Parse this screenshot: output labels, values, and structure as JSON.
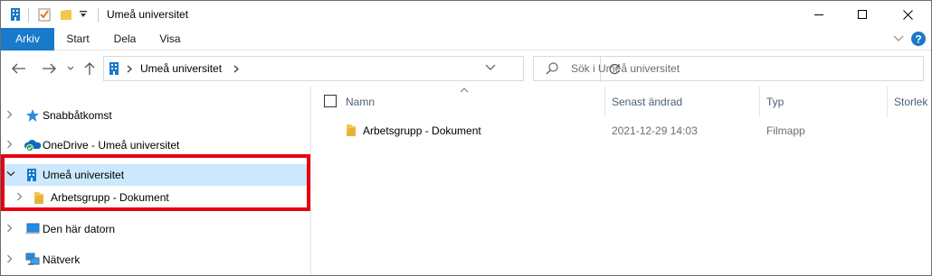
{
  "window": {
    "title": "Umeå universitet"
  },
  "ribbon": {
    "tabs": [
      {
        "label": "Arkiv",
        "active": true
      },
      {
        "label": "Start",
        "active": false
      },
      {
        "label": "Dela",
        "active": false
      },
      {
        "label": "Visa",
        "active": false
      }
    ]
  },
  "address": {
    "path": "Umeå universitet",
    "search_placeholder": "Sök i Umeå universitet"
  },
  "nav_pane": {
    "items": [
      {
        "label": "Snabbåtkomst",
        "icon": "star-icon"
      },
      {
        "label": "OneDrive - Umeå universitet",
        "icon": "onedrive-cloud-icon"
      },
      {
        "label": "Umeå universitet",
        "icon": "building-icon",
        "expanded": true,
        "selected": true
      },
      {
        "label": "Arbetsgrupp - Dokument",
        "icon": "folder-icon"
      },
      {
        "label": "Den här datorn",
        "icon": "computer-icon"
      },
      {
        "label": "Nätverk",
        "icon": "network-icon"
      }
    ]
  },
  "file_list": {
    "columns": [
      "Namn",
      "Senast ändrad",
      "Typ",
      "Storlek"
    ],
    "rows": [
      {
        "name": "Arbetsgrupp - Dokument",
        "modified": "2021-12-29 14:03",
        "type": "Filmapp",
        "size": ""
      }
    ]
  },
  "colors": {
    "accent": "#1979ca",
    "selection": "#cce8ff",
    "highlight_box": "#e60012",
    "help": "#1979ca"
  }
}
